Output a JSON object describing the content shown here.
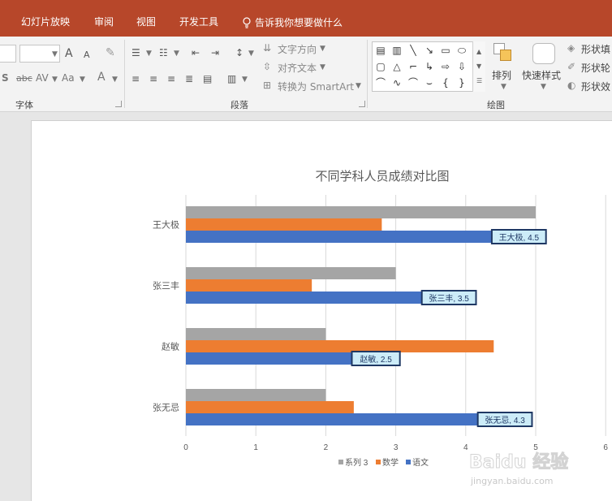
{
  "ribbon_tabs": {
    "slideshow": "幻灯片放映",
    "review": "审阅",
    "view": "视图",
    "developer": "开发工具",
    "tell_me": "告诉我你想要做什么"
  },
  "ribbon": {
    "font_group": "字体",
    "paragraph_group": "段落",
    "drawing_group": "绘图",
    "text_direction": "文字方向",
    "align_text": "对齐文本",
    "convert_smartart": "转换为 SmartArt",
    "arrange": "排列",
    "quick_styles": "快速样式",
    "shape_fill": "形状填",
    "shape_outline": "形状轮",
    "shape_effects": "形状效",
    "font_color_glyph": "A",
    "case_glyph": "Aa",
    "strike_glyph": "abc",
    "spacing_glyph": "AV",
    "grow_font_glyph": "A",
    "shrink_font_glyph": "A"
  },
  "colors": {
    "tab_bar": "#b7472a",
    "series_yuwen": "#4472c4",
    "series_shuxue": "#ed7d31",
    "series_3": "#a5a5a5",
    "label_fill": "#ccecf8",
    "label_border": "#1f3864"
  },
  "chart_data": {
    "type": "bar",
    "title": "不同学科人员成绩对比图",
    "categories": [
      "王大极",
      "张三丰",
      "赵敏",
      "张无忌"
    ],
    "series": [
      {
        "name": "系列 3",
        "values": [
          5.0,
          3.0,
          2.0,
          2.0
        ]
      },
      {
        "name": "数学",
        "values": [
          2.8,
          1.8,
          4.4,
          2.4
        ]
      },
      {
        "name": "语文",
        "values": [
          4.5,
          3.5,
          2.5,
          4.3
        ]
      }
    ],
    "data_labels": [
      "王大极, 4.5",
      "张三丰, 3.5",
      "赵敏, 2.5",
      "张无忌, 4.3"
    ],
    "xlim": [
      0,
      6
    ],
    "x_ticks": [
      "0",
      "1",
      "2",
      "3",
      "4",
      "5",
      "6"
    ],
    "grid": true,
    "legend_position": "bottom",
    "xlabel": "",
    "ylabel": ""
  },
  "watermark": {
    "brand": "Baidu 经验",
    "url": "jingyan.baidu.com"
  }
}
